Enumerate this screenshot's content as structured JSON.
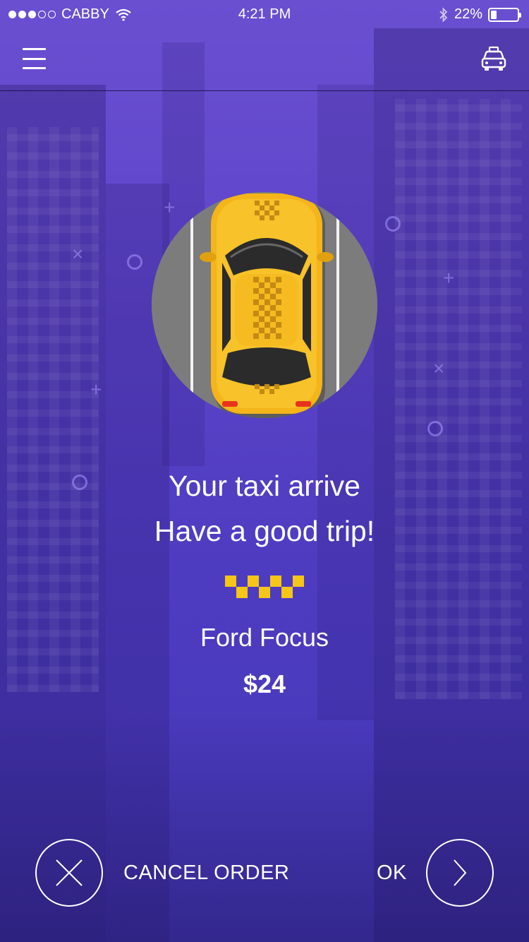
{
  "status_bar": {
    "carrier": "CABBY",
    "time": "4:21 PM",
    "battery_text": "22%",
    "battery_level": 0.22,
    "signal_bars_filled": 3,
    "signal_bars_total": 5
  },
  "nav": {
    "menu_icon": "hamburger-menu-icon",
    "right_icon": "taxi-icon"
  },
  "arrival": {
    "line1": "Your taxi arrive",
    "line2": "Have a good trip!"
  },
  "vehicle": {
    "model": "Ford Focus",
    "price": "$24"
  },
  "actions": {
    "cancel_label": "CANCEL ORDER",
    "ok_label": "OK",
    "cancel_icon": "close-icon",
    "ok_icon": "chevron-right-icon"
  },
  "colors": {
    "background_top": "#6b4fd1",
    "background_bottom": "#4438b8",
    "accent_yellow": "#f5c518",
    "text": "#ffffff"
  }
}
